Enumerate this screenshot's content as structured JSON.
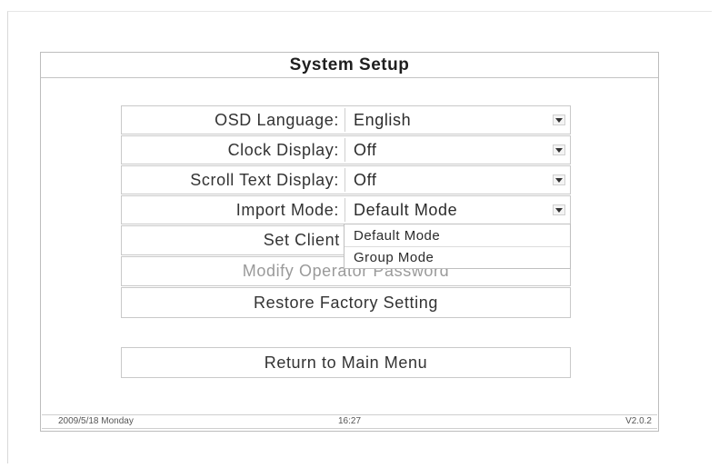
{
  "screen": {
    "title": "System Setup"
  },
  "settings": [
    {
      "label": "OSD Language:",
      "value": "English"
    },
    {
      "label": "Clock Display:",
      "value": "Off"
    },
    {
      "label": "Scroll Text Display:",
      "value": "Off"
    },
    {
      "label": "Import Mode:",
      "value": "Default Mode"
    }
  ],
  "buttons": {
    "set_client_group": "Set Client Gro",
    "modify_operator_password": "Modify Operator Password",
    "restore_factory_setting": "Restore Factory Setting",
    "return_to_main_menu": "Return to Main Menu"
  },
  "import_mode_dropdown": {
    "options": [
      "Default Mode",
      "Group Mode"
    ]
  },
  "status_bar": {
    "date": "2009/5/18 Monday",
    "time": "16:27",
    "version": "V2.0.2"
  },
  "icons": {
    "dropdown_arrow": "chevron-down-icon"
  }
}
